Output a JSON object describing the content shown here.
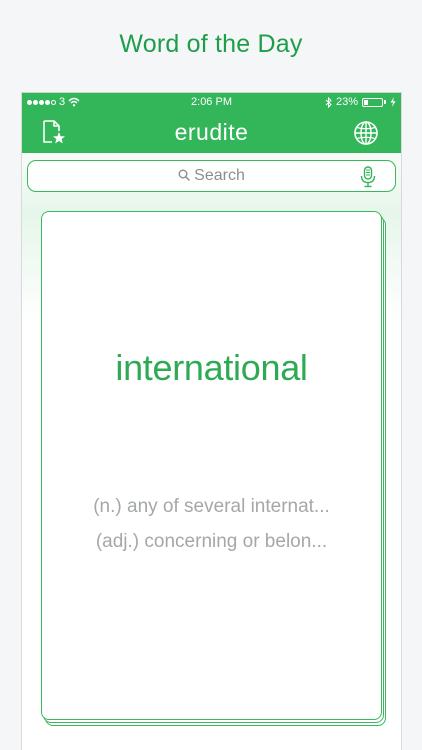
{
  "promo": {
    "title": "Word of the Day"
  },
  "status_bar": {
    "carrier": "3",
    "time": "2:06 PM",
    "battery_text": "23%",
    "battery_level": 0.23
  },
  "nav": {
    "logo": "erudite",
    "left_icon": "favorites-document-icon",
    "right_icon": "globe-icon"
  },
  "search": {
    "placeholder": "Search",
    "icon": "search-icon",
    "mic_icon": "microphone-icon"
  },
  "card": {
    "word": "international",
    "definitions": [
      "(n.) any of several internat...",
      "(adj.) concerning or belon..."
    ]
  },
  "colors": {
    "brand_green": "#33b659",
    "word_green": "#2eaa55",
    "definition_gray": "#a4a8a6"
  }
}
